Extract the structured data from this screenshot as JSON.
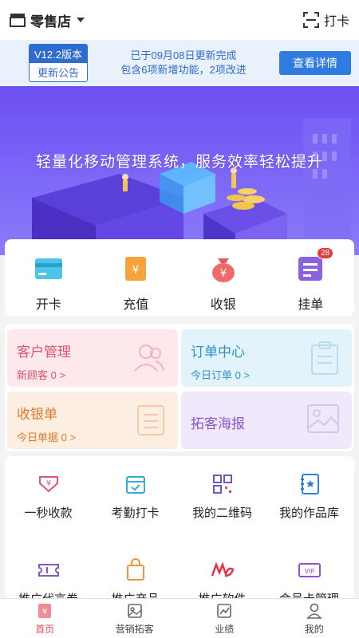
{
  "header": {
    "store_name": "零售店",
    "checkin_label": "打卡"
  },
  "notice": {
    "version_label": "V12.2版本",
    "announcement_label": "更新公告",
    "line1": "已于09月08日更新完成",
    "line2": "包含6项新增功能，2项改进",
    "detail_button": "查看详情"
  },
  "banner": {
    "title": "轻量化移动管理系统，服务效率轻松提升"
  },
  "quick_actions": [
    {
      "label": "开卡",
      "icon": "card-icon"
    },
    {
      "label": "充值",
      "icon": "recharge-icon"
    },
    {
      "label": "收银",
      "icon": "money-bag-icon"
    },
    {
      "label": "挂单",
      "icon": "hold-order-icon",
      "badge": "28"
    }
  ],
  "cards": {
    "customer": {
      "title": "客户管理",
      "sub": "新顾客 0 >"
    },
    "orders": {
      "title": "订单中心",
      "sub": "今日订单 0 >"
    },
    "receipts": {
      "title": "收银单",
      "sub": "今日单据 0 >"
    },
    "poster": {
      "title": "拓客海报"
    }
  },
  "features": [
    {
      "label": "一秒收款",
      "icon": "quick-pay-icon"
    },
    {
      "label": "考勤打卡",
      "icon": "calendar-check-icon"
    },
    {
      "label": "我的二维码",
      "icon": "qrcode-icon"
    },
    {
      "label": "我的作品库",
      "icon": "portfolio-icon"
    },
    {
      "label": "推广代言券",
      "icon": "ticket-icon"
    },
    {
      "label": "推广产品",
      "icon": "bag-icon"
    },
    {
      "label": "推广软件",
      "icon": "logo-md-icon"
    },
    {
      "label": "会员卡管理",
      "icon": "vip-card-icon"
    }
  ],
  "tabs": [
    {
      "label": "首页",
      "icon": "home-icon",
      "active": true
    },
    {
      "label": "营销拓客",
      "icon": "marketing-icon",
      "active": false
    },
    {
      "label": "业绩",
      "icon": "chart-icon",
      "active": false
    },
    {
      "label": "我的",
      "icon": "user-icon",
      "active": false
    }
  ],
  "colors": {
    "accent": "#2f7be0",
    "active_tab": "#e24a5a",
    "banner": "#6e4ff2"
  }
}
